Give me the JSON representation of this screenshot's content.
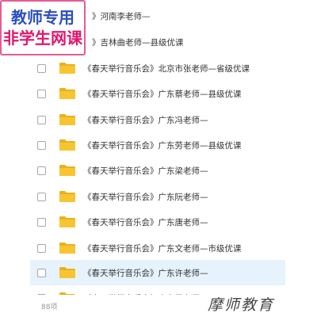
{
  "list": {
    "items": [
      {
        "name": "》河南李老师—",
        "highlighted": false,
        "partial": true
      },
      {
        "name": "》吉林曲老师—县级优课",
        "highlighted": false,
        "partial": true
      },
      {
        "name": "《春天举行音乐会》北京市张老师—省级优课",
        "highlighted": false
      },
      {
        "name": "《春天举行音乐会》广东蔡老师—县级优课",
        "highlighted": false
      },
      {
        "name": "《春天举行音乐会》广东冯老师—",
        "highlighted": false
      },
      {
        "name": "《春天举行音乐会》广东劳老师—县级优课",
        "highlighted": false
      },
      {
        "name": "《春天举行音乐会》广东梁老师—",
        "highlighted": false
      },
      {
        "name": "《春天举行音乐会》广东阮老师—",
        "highlighted": false
      },
      {
        "name": "《春天举行音乐会》广东唐老师—",
        "highlighted": false
      },
      {
        "name": "《春天举行音乐会》广东文老师—市级优课",
        "highlighted": false
      },
      {
        "name": "《春天举行音乐会》广东许老师—",
        "highlighted": true
      },
      {
        "name": "《春天举行音乐会》广东周老师—",
        "highlighted": false,
        "cut_off": true
      }
    ]
  },
  "footer": {
    "item_count": "88项"
  },
  "badge": {
    "line1": "教师专用",
    "line2": "非学生网课"
  },
  "watermark": {
    "text": "摩师教育"
  },
  "colors": {
    "folder": "#f7c531",
    "folder_dark": "#e8b21c",
    "highlight_row": "#e6f3fc",
    "badge_border": "#e85a93",
    "badge_line1": "#2d4fbf",
    "badge_line2": "#e0176f"
  },
  "icons": {
    "folder": "folder-icon",
    "checkbox": "checkbox"
  }
}
